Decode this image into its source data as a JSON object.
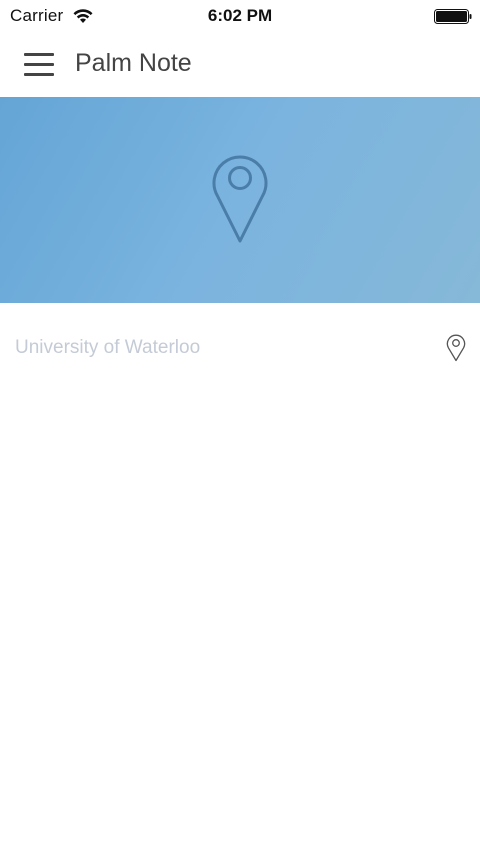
{
  "status_bar": {
    "carrier": "Carrier",
    "time": "6:02 PM",
    "wifi_icon": "wifi-icon",
    "battery_icon": "battery-icon"
  },
  "nav_bar": {
    "menu_icon": "hamburger-menu-icon",
    "title": "Palm Note"
  },
  "banner": {
    "icon": "map-pin-icon",
    "gradient_colors": [
      "#64a5d6",
      "#7bb4df",
      "#86b8d8"
    ]
  },
  "location": {
    "value": "University of Waterloo",
    "icon": "map-pin-icon"
  }
}
